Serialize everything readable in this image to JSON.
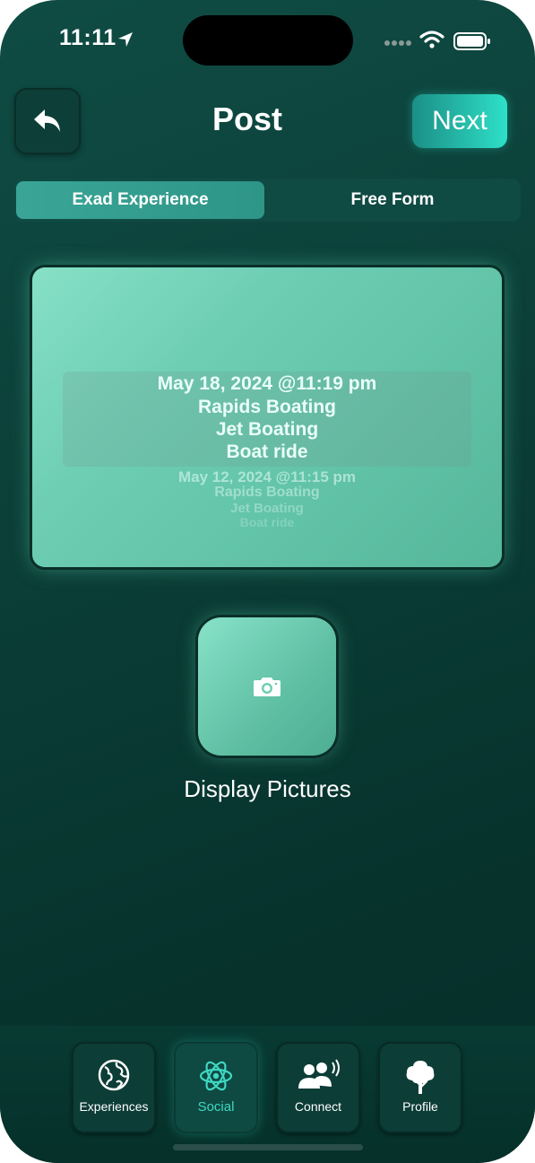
{
  "status_bar": {
    "time": "11:11"
  },
  "header": {
    "title": "Post",
    "next_label": "Next"
  },
  "segmented_control": {
    "options": [
      {
        "label": "Exad Experience",
        "selected": true
      },
      {
        "label": "Free Form",
        "selected": false
      }
    ]
  },
  "picker": {
    "selected": {
      "date": "May 18, 2024 @11:19 pm",
      "lines": [
        "Rapids Boating",
        "Jet Boating",
        "Boat ride"
      ]
    },
    "next": {
      "date": "May 12, 2024 @11:15 pm",
      "lines": [
        "Rapids Boating",
        "Jet Boating",
        "Boat ride"
      ]
    }
  },
  "photo": {
    "label": "Display Pictures",
    "icon": "camera-icon"
  },
  "tabs": [
    {
      "label": "Experiences",
      "icon": "globe-icon",
      "active": false
    },
    {
      "label": "Social",
      "icon": "atom-icon",
      "active": true
    },
    {
      "label": "Connect",
      "icon": "people-voice-icon",
      "active": false
    },
    {
      "label": "Profile",
      "icon": "tree-icon",
      "active": false
    }
  ],
  "colors": {
    "accent": "#2ee0c8",
    "card": "#6ccdb2",
    "background": "#0b3f38"
  }
}
